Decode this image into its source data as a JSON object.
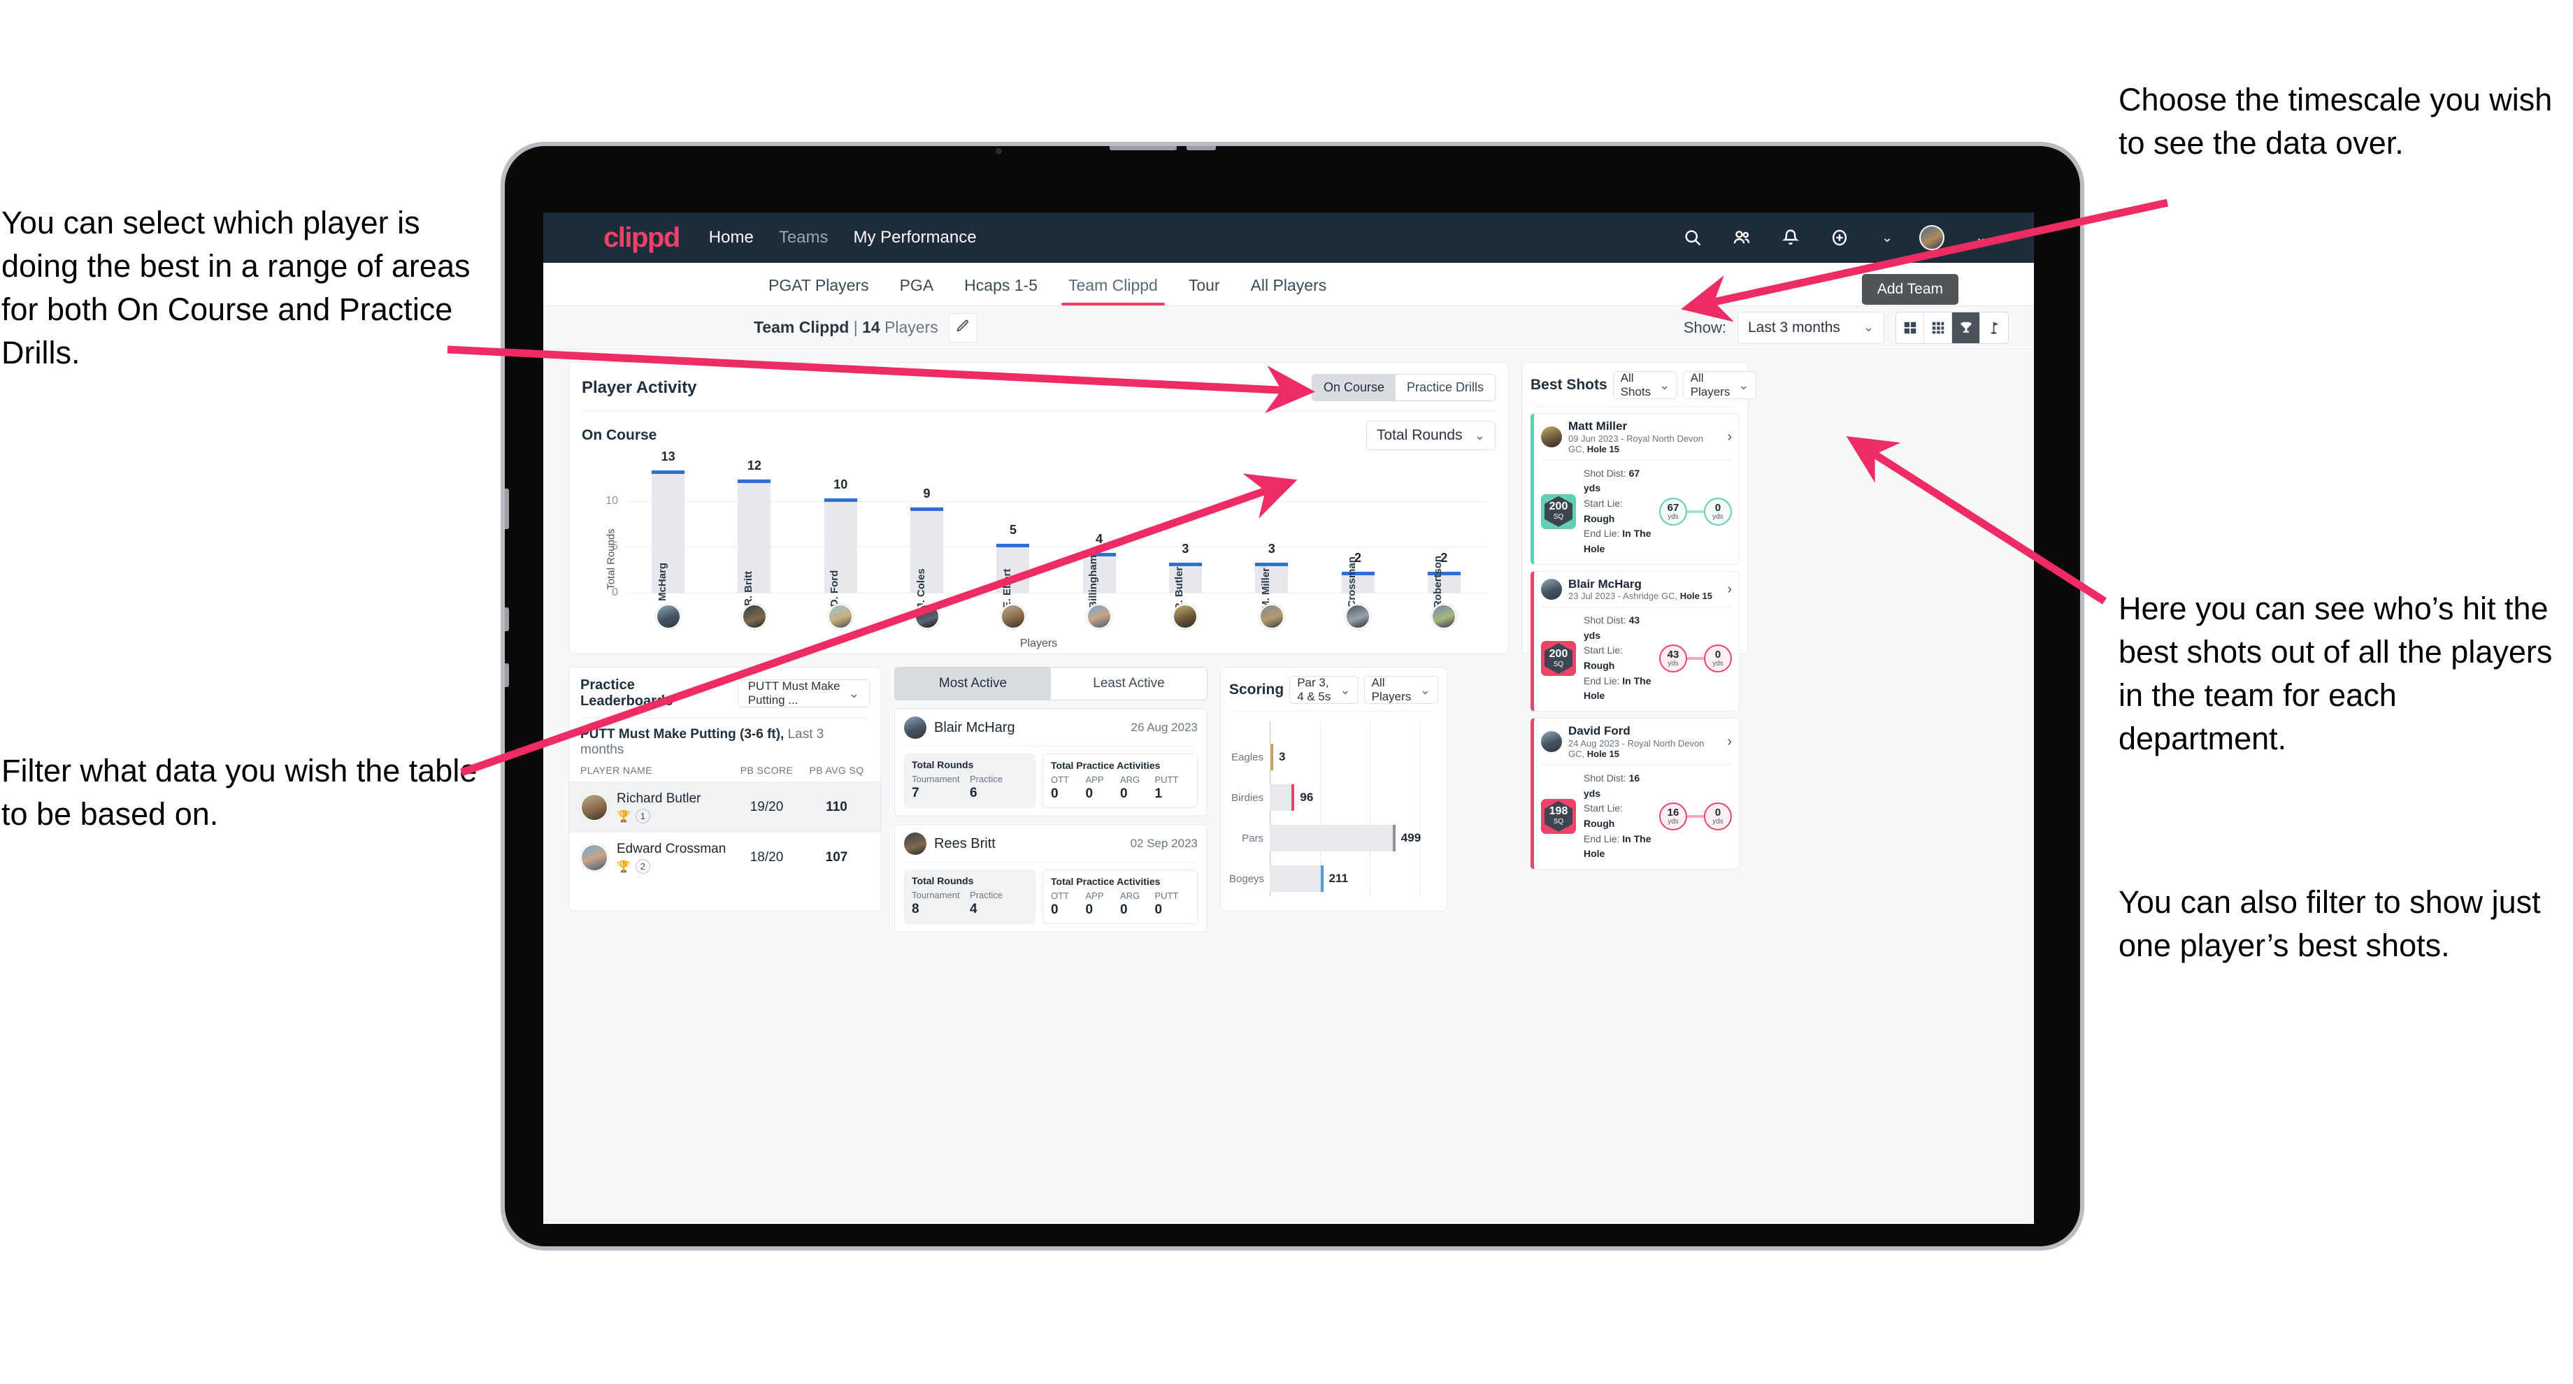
{
  "annotations": {
    "left_top": "You can select which player is doing the best in a range of areas for both On Course and Practice Drills.",
    "left_bottom": "Filter what data you wish the table to be based on.",
    "right_top": "Choose the timescale you wish to see the data over.",
    "right_mid": "Here you can see who’s hit the best shots out of all the players in the team for each department.",
    "right_bottom": "You can also filter to show just one player’s best shots."
  },
  "colors": {
    "brand_pink": "#ef4268",
    "navy": "#1d2b3a",
    "teal": "#62cfb0",
    "bar_blue": "#2f6fd0"
  },
  "topbar": {
    "brand": "clippd",
    "nav": [
      {
        "label": "Home",
        "dim": false
      },
      {
        "label": "Teams",
        "dim": true
      },
      {
        "label": "My Performance",
        "dim": false
      }
    ],
    "icons": [
      "search-icon",
      "people-icon",
      "bell-icon",
      "plus-circle-icon",
      "avatar"
    ]
  },
  "tabs": [
    {
      "label": "PGAT Players",
      "active": false
    },
    {
      "label": "PGA",
      "active": false
    },
    {
      "label": "Hcaps 1-5",
      "active": false
    },
    {
      "label": "Team Clippd",
      "active": true
    },
    {
      "label": "Tour",
      "active": false
    },
    {
      "label": "All Players",
      "active": false
    }
  ],
  "tooltip": {
    "add_team": "Add Team"
  },
  "toolbar": {
    "team_name": "Team Clippd",
    "separator": "|",
    "player_count": "14",
    "players_word": "Players",
    "edit_icon": "pencil-icon",
    "show_label": "Show:",
    "timescale_value": "Last 3 months",
    "view_buttons": [
      "grid-large-icon",
      "grid-small-icon",
      "trophy-icon",
      "flag-icon"
    ],
    "view_active_index": 2
  },
  "player_activity": {
    "title": "Player Activity",
    "segments": [
      {
        "label": "On Course",
        "active": true
      },
      {
        "label": "Practice Drills",
        "active": false
      }
    ],
    "sub_label": "On Course",
    "metric_select": "Total Rounds"
  },
  "chart_data": {
    "type": "bar",
    "title": "Player Activity — On Course",
    "xlabel": "Players",
    "ylabel": "Total Rounds",
    "ylim": [
      0,
      14
    ],
    "yticks": [
      0,
      5,
      10
    ],
    "grid": true,
    "categories": [
      "B. McHarg",
      "R. Britt",
      "D. Ford",
      "J. Coles",
      "E. Ebert",
      "D. Billingham",
      "R. Butler",
      "M. Miller",
      "E. Crossman",
      "C. Robertson"
    ],
    "values": [
      13,
      12,
      10,
      9,
      5,
      4,
      3,
      3,
      2,
      2
    ]
  },
  "best_shots": {
    "title": "Best Shots",
    "shot_filter": "All Shots",
    "player_filter": "All Players",
    "cards": [
      {
        "name": "Matt Miller",
        "meta_plain": "09 Jun 2023 - Royal North Devon GC, ",
        "meta_bold": "Hole 15",
        "sq": "200",
        "sq_unit": "SQ",
        "accent": "teal",
        "shot_dist_label": "Shot Dist: ",
        "shot_dist": "67 yds",
        "start_lie_label": "Start Lie: ",
        "start_lie": "Rough",
        "end_lie_label": "End Lie: ",
        "end_lie": "In The Hole",
        "from_value": "67",
        "from_unit": "yds",
        "to_value": "0",
        "to_unit": "yds"
      },
      {
        "name": "Blair McHarg",
        "meta_plain": "23 Jul 2023 - Ashridge GC, ",
        "meta_bold": "Hole 15",
        "sq": "200",
        "sq_unit": "SQ",
        "accent": "pink",
        "shot_dist_label": "Shot Dist: ",
        "shot_dist": "43 yds",
        "start_lie_label": "Start Lie: ",
        "start_lie": "Rough",
        "end_lie_label": "End Lie: ",
        "end_lie": "In The Hole",
        "from_value": "43",
        "from_unit": "yds",
        "to_value": "0",
        "to_unit": "yds"
      },
      {
        "name": "David Ford",
        "meta_plain": "24 Aug 2023 - Royal North Devon GC, ",
        "meta_bold": "Hole 15",
        "sq": "198",
        "sq_unit": "SQ",
        "accent": "pink",
        "shot_dist_label": "Shot Dist: ",
        "shot_dist": "16 yds",
        "start_lie_label": "Start Lie: ",
        "start_lie": "Rough",
        "end_lie_label": "End Lie: ",
        "end_lie": "In The Hole",
        "from_value": "16",
        "from_unit": "yds",
        "to_value": "0",
        "to_unit": "yds"
      }
    ]
  },
  "practice_leaderboards": {
    "title": "Practice Leaderboards",
    "drill_select": "PUTT Must Make Putting ...",
    "subtitle_bold": "PUTT Must Make Putting (3-6 ft),",
    "subtitle_plain": " Last 3 months",
    "columns": [
      "PLAYER NAME",
      "PB SCORE",
      "PB AVG SQ"
    ],
    "rows": [
      {
        "name": "Richard Butler",
        "rank": "1",
        "trophy": "gold",
        "pb_score": "19/20",
        "pb_avg_sq": "110",
        "highlight": true
      },
      {
        "name": "Edward Crossman",
        "rank": "2",
        "trophy": "silver",
        "pb_score": "18/20",
        "pb_avg_sq": "107",
        "highlight": false
      }
    ]
  },
  "activity": {
    "tabs": [
      {
        "label": "Most Active",
        "active": true
      },
      {
        "label": "Least Active",
        "active": false
      }
    ],
    "cards": [
      {
        "name": "Blair McHarg",
        "date": "26 Aug 2023",
        "rounds_title": "Total Rounds",
        "rounds": [
          {
            "key": "Tournament",
            "value": "7"
          },
          {
            "key": "Practice",
            "value": "6"
          }
        ],
        "practice_title": "Total Practice Activities",
        "practice": [
          {
            "key": "OTT",
            "value": "0"
          },
          {
            "key": "APP",
            "value": "0"
          },
          {
            "key": "ARG",
            "value": "0"
          },
          {
            "key": "PUTT",
            "value": "1"
          }
        ]
      },
      {
        "name": "Rees Britt",
        "date": "02 Sep 2023",
        "rounds_title": "Total Rounds",
        "rounds": [
          {
            "key": "Tournament",
            "value": "8"
          },
          {
            "key": "Practice",
            "value": "4"
          }
        ],
        "practice_title": "Total Practice Activities",
        "practice": [
          {
            "key": "OTT",
            "value": "0"
          },
          {
            "key": "APP",
            "value": "0"
          },
          {
            "key": "ARG",
            "value": "0"
          },
          {
            "key": "PUTT",
            "value": "0"
          }
        ]
      }
    ]
  },
  "scoring": {
    "title": "Scoring",
    "par_filter": "Par 3, 4 & 5s",
    "player_filter": "All Players",
    "chart_data": {
      "type": "bar",
      "orientation": "horizontal",
      "title": "Scoring",
      "categories": [
        "Eagles",
        "Birdies",
        "Pars",
        "Bogeys"
      ],
      "values": [
        3,
        96,
        499,
        211
      ],
      "colors": [
        "#c4a257",
        "#ef4268",
        "#8b9199",
        "#4e9ad6"
      ],
      "xlim": [
        0,
        600
      ],
      "grid": true
    }
  }
}
